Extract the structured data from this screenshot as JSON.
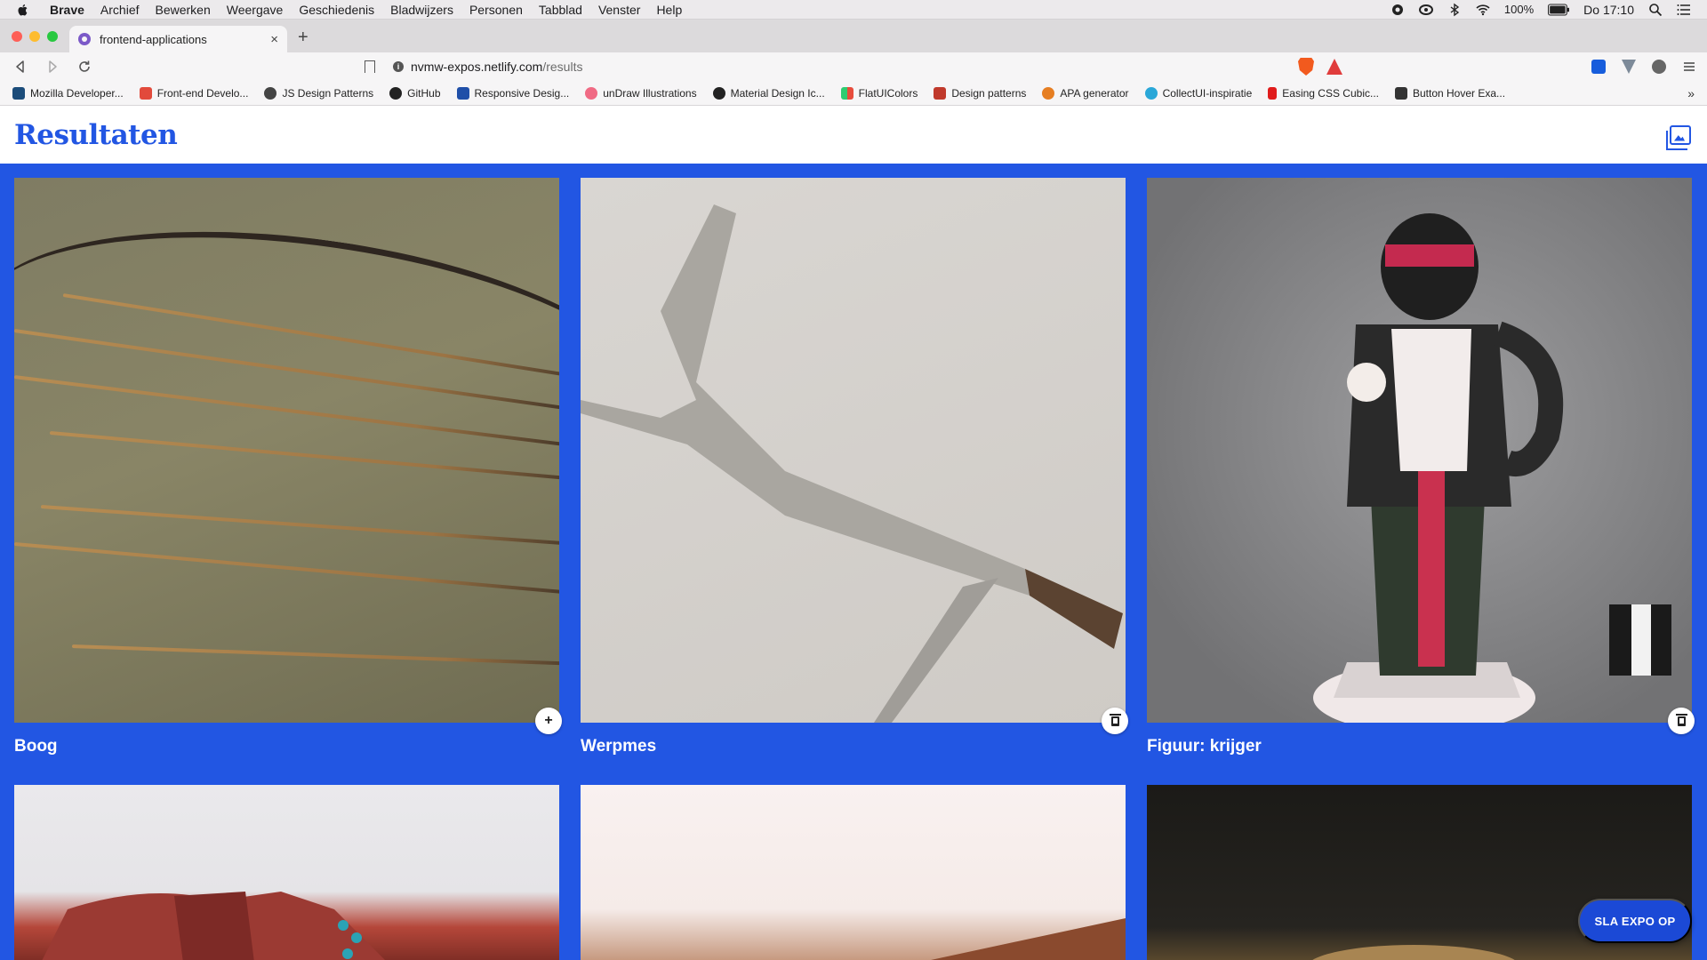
{
  "menubar": {
    "app": "Brave",
    "items": [
      "Archief",
      "Bewerken",
      "Weergave",
      "Geschiedenis",
      "Bladwijzers",
      "Personen",
      "Tabblad",
      "Venster",
      "Help"
    ],
    "battery": "100%",
    "clock": "Do 17:10"
  },
  "tab": {
    "title": "frontend-applications",
    "close": "×",
    "new": "+"
  },
  "address": {
    "host": "nvmw-expos.netlify.com",
    "path": "/results"
  },
  "bookmarks": [
    {
      "label": "Mozilla Developer...",
      "icon": "mdn-icon",
      "color": "#1b4c7a"
    },
    {
      "label": "Front-end Develo...",
      "icon": "fed-icon",
      "color": "#e24a3b"
    },
    {
      "label": "JS Design Patterns",
      "icon": "globe-icon",
      "color": "#444444"
    },
    {
      "label": "GitHub",
      "icon": "github-icon",
      "color": "#222222"
    },
    {
      "label": "Responsive Desig...",
      "icon": "rd-icon",
      "color": "#1f4fa8"
    },
    {
      "label": "unDraw Illustrations",
      "icon": "undraw-icon",
      "color": "#f06a84"
    },
    {
      "label": "Material Design Ic...",
      "icon": "material-icon",
      "color": "#222222"
    },
    {
      "label": "FlatUIColors",
      "icon": "flatui-icon",
      "color": "#2ecc71"
    },
    {
      "label": "Design patterns",
      "icon": "ui-icon",
      "color": "#c0392b"
    },
    {
      "label": "APA generator",
      "icon": "apa-icon",
      "color": "#e67e22"
    },
    {
      "label": "CollectUI-inspiratie",
      "icon": "collectui-icon",
      "color": "#2aa7d8"
    },
    {
      "label": "Easing CSS Cubic...",
      "icon": "easing-icon",
      "color": "#e01b1b"
    },
    {
      "label": "Button Hover Exa...",
      "icon": "facebook-icon",
      "color": "#333333"
    }
  ],
  "bookmarks_more": "»",
  "page": {
    "title": "Resultaten",
    "results": [
      {
        "title": "Boog",
        "action": "+"
      },
      {
        "title": "Werpmes",
        "action": "delete"
      },
      {
        "title": "Figuur: krijger",
        "action": "delete"
      },
      {
        "title": ""
      },
      {
        "title": ""
      },
      {
        "title": ""
      }
    ],
    "save_button": "SLA EXPO OP"
  },
  "colors": {
    "accent": "#2256e3",
    "save_button": "#1b49d6"
  }
}
